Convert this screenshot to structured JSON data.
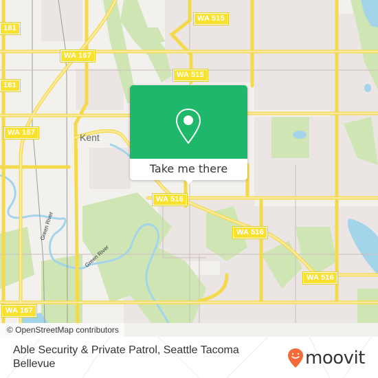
{
  "map": {
    "place_labels": [
      {
        "name": "Kent"
      }
    ],
    "route_shields": [
      {
        "label": "181"
      },
      {
        "label": "WA 167"
      },
      {
        "label": "WA 515"
      },
      {
        "label": "181"
      },
      {
        "label": "WA 515"
      },
      {
        "label": "WA 167"
      },
      {
        "label": "WA 516"
      },
      {
        "label": "WA 516"
      },
      {
        "label": "WA 516"
      },
      {
        "label": "WA 167"
      }
    ],
    "river_labels": [
      "Green River",
      "Green River"
    ],
    "attribution": "© OpenStreetMap contributors",
    "colors": {
      "land": "#f3f1ee",
      "urban": "#ebe5e3",
      "park": "#cfe6b4",
      "water": "#a3d4ea",
      "road": "#f9e57a",
      "accent": "#1fb86a"
    }
  },
  "popup": {
    "icon": "map-pin-icon",
    "button_label": "Take me there"
  },
  "footer": {
    "title": "Able Security & Private Patrol, Seattle Tacoma Bellevue",
    "logo_text": "moovit",
    "logo_color": "#f26b38"
  }
}
